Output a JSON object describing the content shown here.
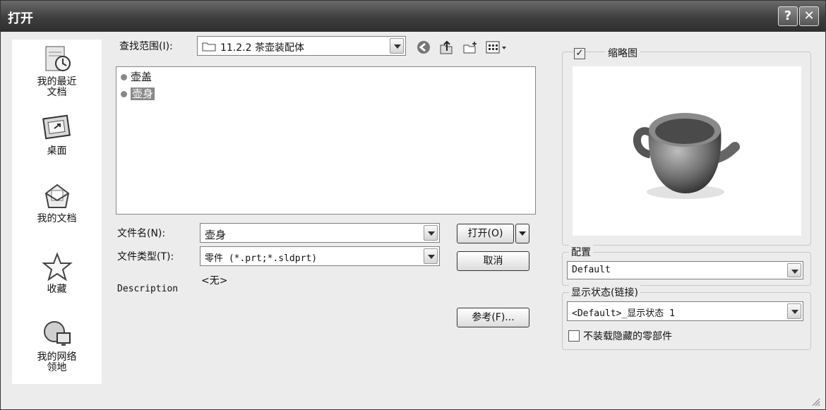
{
  "window": {
    "title": "打开",
    "help_label": "?",
    "close_label": "✕"
  },
  "places": [
    {
      "label_line1": "我的最近",
      "label_line2": "文档",
      "icon": "recent-documents-icon"
    },
    {
      "label_line1": "桌面",
      "label_line2": "",
      "icon": "desktop-icon"
    },
    {
      "label_line1": "我的文档",
      "label_line2": "",
      "icon": "my-documents-icon"
    },
    {
      "label_line1": "收藏",
      "label_line2": "",
      "icon": "favorites-star-icon"
    },
    {
      "label_line1": "我的网络",
      "label_line2": "领地",
      "icon": "network-places-icon"
    }
  ],
  "lookin": {
    "label": "查找范围(I):",
    "value": "11.2.2 茶壶装配体"
  },
  "files": [
    {
      "name": "壶盖",
      "selected": false
    },
    {
      "name": "壶身",
      "selected": true
    }
  ],
  "filename": {
    "label": "文件名(N):",
    "value": "壶身"
  },
  "filetype": {
    "label": "文件类型(T):",
    "value": "零件 (*.prt;*.sldprt)"
  },
  "description": {
    "label": "Description",
    "value": "<无>"
  },
  "buttons": {
    "open": "打开(O)",
    "cancel": "取消",
    "references": "参考(F)..."
  },
  "thumbnail": {
    "label": "缩略图",
    "checked": true,
    "check_mark": "✓"
  },
  "config": {
    "label": "配置",
    "value": "Default"
  },
  "display_state": {
    "label": "显示状态(链接)",
    "value": "<Default>_显示状态 1"
  },
  "hidden_components": {
    "label": "不装载隐藏的零部件",
    "checked": false
  }
}
